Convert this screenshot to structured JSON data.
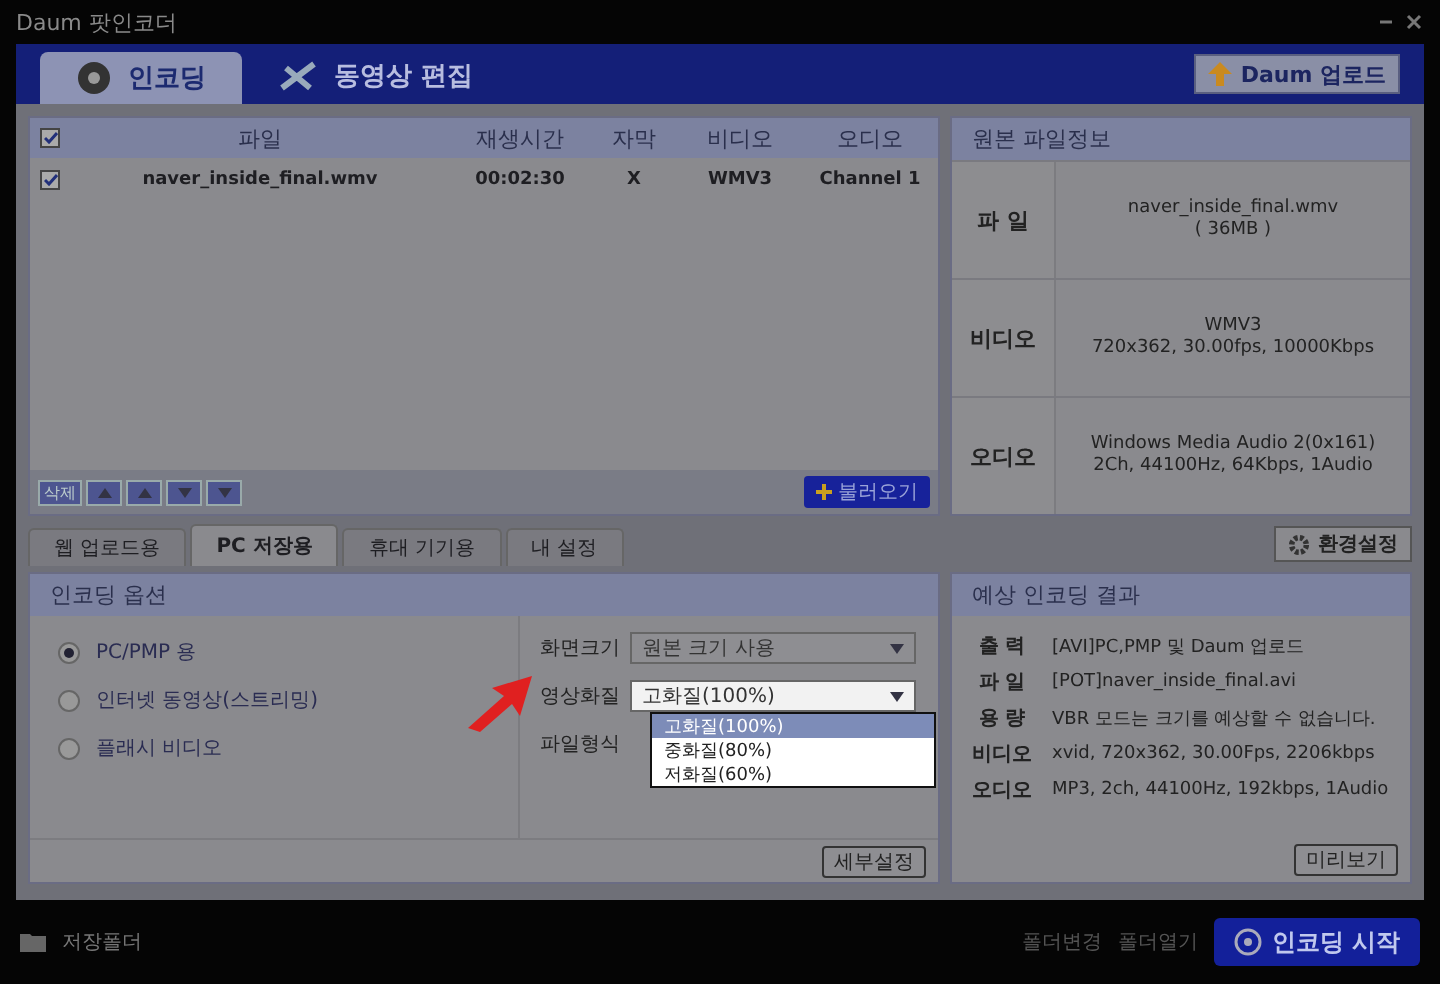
{
  "window": {
    "title": "Daum 팟인코더"
  },
  "main_tabs": [
    {
      "label": "인코딩",
      "selected": true
    },
    {
      "label": "동영상 편집",
      "selected": false
    }
  ],
  "upload_button": "Daum 업로드",
  "file_table": {
    "header_checked": true,
    "columns": [
      "파일",
      "재생시간",
      "자막",
      "비디오",
      "오디오"
    ],
    "rows": [
      {
        "checked": true,
        "cells": [
          "naver_inside_final.wmv",
          "00:02:30",
          "X",
          "WMV3",
          "Channel 1"
        ]
      }
    ]
  },
  "list_controls": {
    "delete": "삭제",
    "load": "불러오기"
  },
  "source_info": {
    "title": "원본 파일정보",
    "rows": [
      {
        "label": "파 일",
        "lines": [
          "naver_inside_final.wmv",
          "( 36MB )"
        ]
      },
      {
        "label": "비디오",
        "lines": [
          "WMV3",
          "720x362, 30.00fps, 10000Kbps"
        ]
      },
      {
        "label": "오디오",
        "lines": [
          "Windows Media Audio 2(0x161)",
          "2Ch, 44100Hz, 64Kbps, 1Audio"
        ]
      }
    ]
  },
  "profile_tabs": [
    {
      "label": "웹 업로드용",
      "selected": false
    },
    {
      "label": "PC 저장용",
      "selected": true
    },
    {
      "label": "휴대 기기용",
      "selected": false
    },
    {
      "label": "내 설정",
      "selected": false
    }
  ],
  "settings_button": "환경설정",
  "options": {
    "title": "인코딩 옵션",
    "modes": [
      {
        "label": "PC/PMP 용",
        "selected": true
      },
      {
        "label": "인터넷 동영상(스트리밍)",
        "selected": false
      },
      {
        "label": "플래시 비디오",
        "selected": false
      }
    ],
    "fields": [
      {
        "kind": "select",
        "label": "화면크기",
        "value": "원본 크기 사용",
        "expanded": false
      },
      {
        "kind": "select",
        "label": "영상화질",
        "value": "고화질(100%)",
        "expanded": true,
        "options": [
          {
            "label": "고화질(100%)",
            "selected": true
          },
          {
            "label": "중화질(80%)",
            "selected": false
          },
          {
            "label": "저화질(60%)",
            "selected": false
          }
        ]
      },
      {
        "kind": "label",
        "label": "파일형식"
      }
    ],
    "detail_button": "세부설정"
  },
  "result": {
    "title": "예상 인코딩 결과",
    "rows": [
      {
        "label": "출 력",
        "value": "[AVI]PC,PMP 및 Daum 업로드"
      },
      {
        "label": "파 일",
        "value": "[POT]naver_inside_final.avi"
      },
      {
        "label": "용 량",
        "value": "VBR 모드는 크기를 예상할 수 없습니다."
      },
      {
        "label": "비디오",
        "value": "xvid, 720x362, 30.00Fps, 2206kbps"
      },
      {
        "label": "오디오",
        "value": "MP3, 2ch, 44100Hz, 192kbps, 1Audio"
      }
    ],
    "preview_button": "미리보기"
  },
  "footer": {
    "folder_label": "저장폴더",
    "links": [
      "폴더변경",
      "폴더열기"
    ],
    "start_button": "인코딩 시작"
  }
}
